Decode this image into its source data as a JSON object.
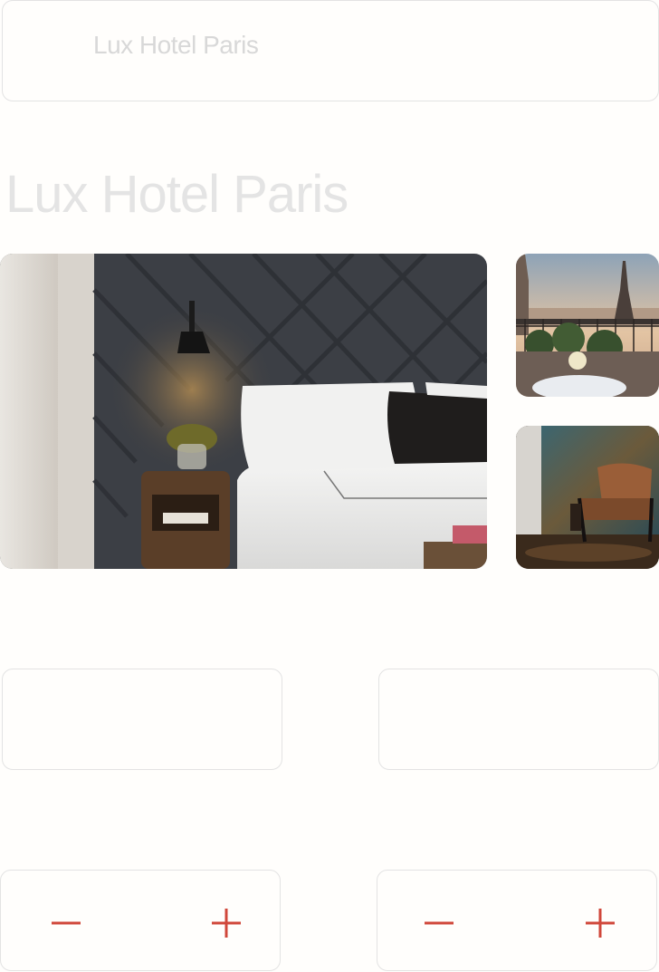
{
  "header": {
    "title": "Lux Hotel Paris"
  },
  "main": {
    "title": "Lux Hotel Paris"
  },
  "gallery": {
    "images": [
      {
        "description": "bedroom-photo"
      },
      {
        "description": "eiffel-tower-terrace-photo"
      },
      {
        "description": "leather-armchair-photo"
      }
    ]
  },
  "booking": {
    "checkin": {
      "value": ""
    },
    "checkout": {
      "value": ""
    },
    "adults": {
      "value": "",
      "minus_icon": "minus-icon",
      "plus_icon": "plus-icon"
    },
    "children": {
      "value": "",
      "minus_icon": "minus-icon",
      "plus_icon": "plus-icon"
    }
  },
  "colors": {
    "accent": "#d0473a",
    "border": "#e3e3e3",
    "background": "#fffefc"
  }
}
